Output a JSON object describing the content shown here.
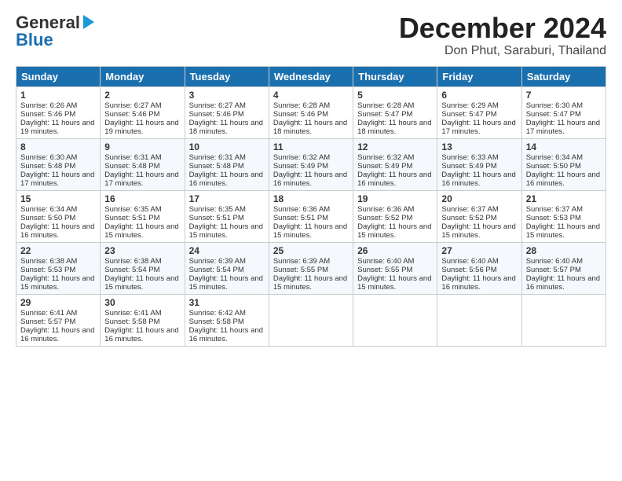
{
  "logo": {
    "line1": "General",
    "line2": "Blue"
  },
  "title": "December 2024",
  "subtitle": "Don Phut, Saraburi, Thailand",
  "days": [
    "Sunday",
    "Monday",
    "Tuesday",
    "Wednesday",
    "Thursday",
    "Friday",
    "Saturday"
  ],
  "weeks": [
    [
      {
        "num": "1",
        "sunrise": "6:26 AM",
        "sunset": "5:46 PM",
        "daylight": "11 hours and 19 minutes."
      },
      {
        "num": "2",
        "sunrise": "6:27 AM",
        "sunset": "5:46 PM",
        "daylight": "11 hours and 19 minutes."
      },
      {
        "num": "3",
        "sunrise": "6:27 AM",
        "sunset": "5:46 PM",
        "daylight": "11 hours and 18 minutes."
      },
      {
        "num": "4",
        "sunrise": "6:28 AM",
        "sunset": "5:46 PM",
        "daylight": "11 hours and 18 minutes."
      },
      {
        "num": "5",
        "sunrise": "6:28 AM",
        "sunset": "5:47 PM",
        "daylight": "11 hours and 18 minutes."
      },
      {
        "num": "6",
        "sunrise": "6:29 AM",
        "sunset": "5:47 PM",
        "daylight": "11 hours and 17 minutes."
      },
      {
        "num": "7",
        "sunrise": "6:30 AM",
        "sunset": "5:47 PM",
        "daylight": "11 hours and 17 minutes."
      }
    ],
    [
      {
        "num": "8",
        "sunrise": "6:30 AM",
        "sunset": "5:48 PM",
        "daylight": "11 hours and 17 minutes."
      },
      {
        "num": "9",
        "sunrise": "6:31 AM",
        "sunset": "5:48 PM",
        "daylight": "11 hours and 17 minutes."
      },
      {
        "num": "10",
        "sunrise": "6:31 AM",
        "sunset": "5:48 PM",
        "daylight": "11 hours and 16 minutes."
      },
      {
        "num": "11",
        "sunrise": "6:32 AM",
        "sunset": "5:49 PM",
        "daylight": "11 hours and 16 minutes."
      },
      {
        "num": "12",
        "sunrise": "6:32 AM",
        "sunset": "5:49 PM",
        "daylight": "11 hours and 16 minutes."
      },
      {
        "num": "13",
        "sunrise": "6:33 AM",
        "sunset": "5:49 PM",
        "daylight": "11 hours and 16 minutes."
      },
      {
        "num": "14",
        "sunrise": "6:34 AM",
        "sunset": "5:50 PM",
        "daylight": "11 hours and 16 minutes."
      }
    ],
    [
      {
        "num": "15",
        "sunrise": "6:34 AM",
        "sunset": "5:50 PM",
        "daylight": "11 hours and 16 minutes."
      },
      {
        "num": "16",
        "sunrise": "6:35 AM",
        "sunset": "5:51 PM",
        "daylight": "11 hours and 15 minutes."
      },
      {
        "num": "17",
        "sunrise": "6:35 AM",
        "sunset": "5:51 PM",
        "daylight": "11 hours and 15 minutes."
      },
      {
        "num": "18",
        "sunrise": "6:36 AM",
        "sunset": "5:51 PM",
        "daylight": "11 hours and 15 minutes."
      },
      {
        "num": "19",
        "sunrise": "6:36 AM",
        "sunset": "5:52 PM",
        "daylight": "11 hours and 15 minutes."
      },
      {
        "num": "20",
        "sunrise": "6:37 AM",
        "sunset": "5:52 PM",
        "daylight": "11 hours and 15 minutes."
      },
      {
        "num": "21",
        "sunrise": "6:37 AM",
        "sunset": "5:53 PM",
        "daylight": "11 hours and 15 minutes."
      }
    ],
    [
      {
        "num": "22",
        "sunrise": "6:38 AM",
        "sunset": "5:53 PM",
        "daylight": "11 hours and 15 minutes."
      },
      {
        "num": "23",
        "sunrise": "6:38 AM",
        "sunset": "5:54 PM",
        "daylight": "11 hours and 15 minutes."
      },
      {
        "num": "24",
        "sunrise": "6:39 AM",
        "sunset": "5:54 PM",
        "daylight": "11 hours and 15 minutes."
      },
      {
        "num": "25",
        "sunrise": "6:39 AM",
        "sunset": "5:55 PM",
        "daylight": "11 hours and 15 minutes."
      },
      {
        "num": "26",
        "sunrise": "6:40 AM",
        "sunset": "5:55 PM",
        "daylight": "11 hours and 15 minutes."
      },
      {
        "num": "27",
        "sunrise": "6:40 AM",
        "sunset": "5:56 PM",
        "daylight": "11 hours and 16 minutes."
      },
      {
        "num": "28",
        "sunrise": "6:40 AM",
        "sunset": "5:57 PM",
        "daylight": "11 hours and 16 minutes."
      }
    ],
    [
      {
        "num": "29",
        "sunrise": "6:41 AM",
        "sunset": "5:57 PM",
        "daylight": "11 hours and 16 minutes."
      },
      {
        "num": "30",
        "sunrise": "6:41 AM",
        "sunset": "5:58 PM",
        "daylight": "11 hours and 16 minutes."
      },
      {
        "num": "31",
        "sunrise": "6:42 AM",
        "sunset": "5:58 PM",
        "daylight": "11 hours and 16 minutes."
      },
      null,
      null,
      null,
      null
    ]
  ],
  "labels": {
    "sunrise": "Sunrise: ",
    "sunset": "Sunset: ",
    "daylight": "Daylight: "
  }
}
